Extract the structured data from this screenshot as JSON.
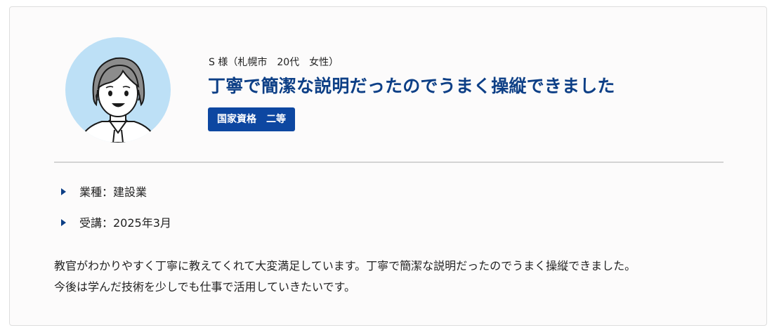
{
  "testimonial": {
    "meta": "S 様（札幌市　20代　女性）",
    "title": "丁寧で簡潔な説明だったのでうまく操縦できました",
    "badge": "国家資格　二等",
    "details": [
      {
        "label": "業種：建設業"
      },
      {
        "label": "受講：2025年3月"
      }
    ],
    "body_lines": [
      "教官がわかりやすく丁寧に教えてくれて大変満足しています。丁寧で簡潔な説明だったのでうまく操縦できました。",
      "今後は学んだ技術を少しでも仕事で活用していきたいです。"
    ],
    "avatar_icon": "person-avatar-icon",
    "detail_bullet_icon": "triangle-right-icon"
  },
  "colors": {
    "accent": "#0d3f86",
    "badge_bg": "#0d47a1",
    "avatar_bg": "#bde0f6"
  }
}
